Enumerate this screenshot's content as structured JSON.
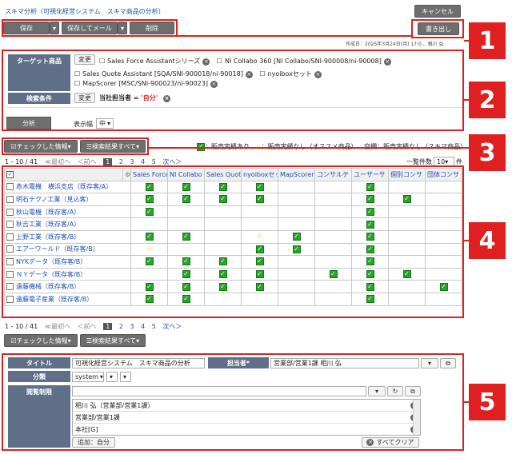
{
  "header": {
    "title": "スキマ分析（可視化経営システム　スキマ商品の分析）",
    "cancel": "キャンセル",
    "export": "書き出し",
    "created": "作成日：2025年3月24日(月) 17:0…  根川 弘"
  },
  "toolbar": {
    "save": "保存",
    "save_mail": "保存してメール",
    "delete": "削除",
    "dd": "▾"
  },
  "filters": {
    "target_label": "ターゲット商品",
    "change": "変更",
    "products": [
      "Sales Force Assistantシリーズ",
      "NI Collabo 360 [NI Collabo/SNI-900008/ni-90008]",
      "Sales Quote Assistant [SQA/SNI-900018/ni-90018]",
      "nyoiboxセット",
      "MapScorer [MSC/SNI-900023/ni-90023]"
    ],
    "cond_label": "検索条件",
    "cond_text": "当社担当者 = ",
    "cond_value": "'自分'",
    "analyze": "分析",
    "width_label": "表示幅",
    "width_value": "中"
  },
  "actions": {
    "checked": "チェックした情報",
    "all_results": "検索結果すべて"
  },
  "legend": {
    "sales": "：販売実績あり",
    "recommend": "：販売実績なし（オススメ商品）",
    "empty": "空欄：販売実績なし（スキマ商品）"
  },
  "pager": {
    "range": "1 - 10 / 41",
    "first": "≪最初へ",
    "prev": "＜前へ",
    "pages": [
      "1",
      "2",
      "3",
      "4",
      "5"
    ],
    "next": "次へ＞",
    "per_page_label": "一覧件数",
    "per_page": "10",
    "unit": "件"
  },
  "grid": {
    "columns": [
      "Sales Force",
      "NI Collabo",
      "Sales Quot",
      "nyoiboxセッ",
      "MapScorer",
      "コンサルテ",
      "ユーザーサ",
      "個別コンサ",
      "団体コンサ"
    ],
    "rows": [
      {
        "name": "赤木電機　横浜支店（既存客/A）",
        "marks": [
          "c",
          "c",
          "c",
          "c",
          "",
          "",
          "c",
          "",
          ""
        ]
      },
      {
        "name": "明石テクノ工業（見込客）",
        "marks": [
          "c",
          "c",
          "c",
          "c",
          "",
          "",
          "c",
          "c",
          ""
        ]
      },
      {
        "name": "秋山電機（既存客/A）",
        "marks": [
          "c",
          "",
          "",
          "",
          "",
          "",
          "c",
          "",
          ""
        ]
      },
      {
        "name": "秋吉工業（既存客/A）",
        "marks": [
          "",
          "",
          "",
          "",
          "",
          "",
          "c",
          "",
          ""
        ]
      },
      {
        "name": "上野工業（既存客/B）",
        "marks": [
          "c",
          "c",
          "",
          "s",
          "c",
          "",
          "c",
          "",
          ""
        ]
      },
      {
        "name": "エアーワールド（既存客/B）",
        "marks": [
          "s",
          "",
          "",
          "c",
          "c",
          "",
          "c",
          "",
          ""
        ]
      },
      {
        "name": "NYKデータ（既存客/B）",
        "marks": [
          "c",
          "c",
          "c",
          "c",
          "",
          "",
          "c",
          "",
          ""
        ]
      },
      {
        "name": "ＮＹデータ（既存客/B）",
        "marks": [
          "",
          "c",
          "c",
          "c",
          "",
          "c",
          "c",
          "c",
          ""
        ]
      },
      {
        "name": "遠藤機械（既存客/B）",
        "marks": [
          "c",
          "c",
          "c",
          "c",
          "",
          "",
          "c",
          "",
          "c"
        ]
      },
      {
        "name": "遠藤電子産業（既存客/B）",
        "marks": [
          "c",
          "c",
          "",
          "",
          "",
          "",
          "c",
          "",
          ""
        ]
      }
    ]
  },
  "form": {
    "title_label": "タイトル",
    "title_value": "可視化経営システム　スキマ商品の分析",
    "owner_label": "担当者*",
    "owner_value": "営業部/営業1課 相川 弘",
    "category_label": "分類",
    "category_value": "system",
    "access_label": "閲覧制限",
    "access_items": [
      "相川 弘（営業部/営業1課）",
      "営業部/営業1課",
      "本社[G]"
    ],
    "add_self": "追加：自分",
    "clear_all": "すべてクリア"
  },
  "callouts": [
    "1",
    "2",
    "3",
    "4",
    "5"
  ],
  "colors": {
    "red": "#e02020",
    "green": "#27a327",
    "star": "#f0b400",
    "label_bg": "#5f6f87"
  }
}
